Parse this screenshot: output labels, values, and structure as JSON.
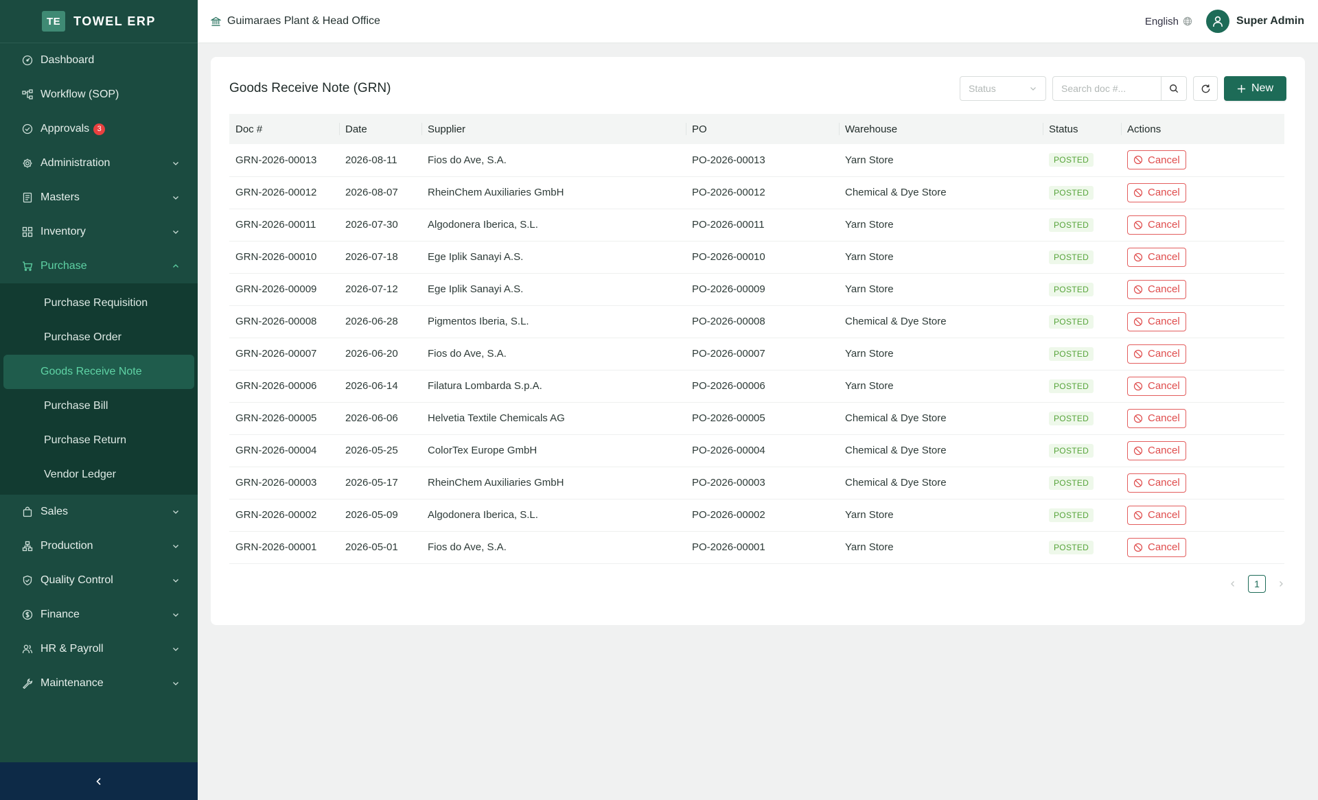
{
  "brand": {
    "logo": "TE",
    "name": "TOWEL ERP"
  },
  "colors": {
    "sidebar": "#1b4b40",
    "accent": "#1d6b57",
    "active_text": "#5fd3a5",
    "danger": "#df4c4c",
    "posted": "#56a43a",
    "collapse_bar": "#0d2a47"
  },
  "sidebar": {
    "items": [
      {
        "label": "Dashboard",
        "icon": "dashboard-icon"
      },
      {
        "label": "Workflow (SOP)",
        "icon": "workflow-icon"
      },
      {
        "label": "Approvals",
        "icon": "check-circle-icon",
        "badge": "3"
      },
      {
        "label": "Administration",
        "icon": "gear-icon"
      },
      {
        "label": "Masters",
        "icon": "book-icon"
      },
      {
        "label": "Inventory",
        "icon": "grid-icon"
      },
      {
        "label": "Purchase",
        "icon": "cart-icon"
      },
      {
        "label": "Sales",
        "icon": "shopping-bag-icon"
      },
      {
        "label": "Production",
        "icon": "cluster-icon"
      },
      {
        "label": "Quality Control",
        "icon": "shield-check-icon"
      },
      {
        "label": "Finance",
        "icon": "dollar-circle-icon"
      },
      {
        "label": "HR & Payroll",
        "icon": "team-icon"
      },
      {
        "label": "Maintenance",
        "icon": "tool-icon"
      }
    ],
    "purchase_sub": [
      "Purchase Requisition",
      "Purchase Order",
      "Goods Receive Note",
      "Purchase Bill",
      "Purchase Return",
      "Vendor Ledger"
    ]
  },
  "header": {
    "org": "Guimaraes Plant & Head Office",
    "language": "English",
    "user": "Super Admin"
  },
  "page": {
    "title": "Goods Receive Note (GRN)",
    "status_placeholder": "Status",
    "search_placeholder": "Search doc #...",
    "new_label": "New"
  },
  "table": {
    "columns": [
      "Doc #",
      "Date",
      "Supplier",
      "PO",
      "Warehouse",
      "Status",
      "Actions"
    ],
    "rows": [
      {
        "doc": "GRN-2026-00013",
        "date": "2026-08-11",
        "supplier": "Fios do Ave, S.A.",
        "po": "PO-2026-00013",
        "warehouse": "Yarn Store",
        "status": "POSTED",
        "action": "Cancel"
      },
      {
        "doc": "GRN-2026-00012",
        "date": "2026-08-07",
        "supplier": "RheinChem Auxiliaries GmbH",
        "po": "PO-2026-00012",
        "warehouse": "Chemical & Dye Store",
        "status": "POSTED",
        "action": "Cancel"
      },
      {
        "doc": "GRN-2026-00011",
        "date": "2026-07-30",
        "supplier": "Algodonera Iberica, S.L.",
        "po": "PO-2026-00011",
        "warehouse": "Yarn Store",
        "status": "POSTED",
        "action": "Cancel"
      },
      {
        "doc": "GRN-2026-00010",
        "date": "2026-07-18",
        "supplier": "Ege Iplik Sanayi A.S.",
        "po": "PO-2026-00010",
        "warehouse": "Yarn Store",
        "status": "POSTED",
        "action": "Cancel"
      },
      {
        "doc": "GRN-2026-00009",
        "date": "2026-07-12",
        "supplier": "Ege Iplik Sanayi A.S.",
        "po": "PO-2026-00009",
        "warehouse": "Yarn Store",
        "status": "POSTED",
        "action": "Cancel"
      },
      {
        "doc": "GRN-2026-00008",
        "date": "2026-06-28",
        "supplier": "Pigmentos Iberia, S.L.",
        "po": "PO-2026-00008",
        "warehouse": "Chemical & Dye Store",
        "status": "POSTED",
        "action": "Cancel"
      },
      {
        "doc": "GRN-2026-00007",
        "date": "2026-06-20",
        "supplier": "Fios do Ave, S.A.",
        "po": "PO-2026-00007",
        "warehouse": "Yarn Store",
        "status": "POSTED",
        "action": "Cancel"
      },
      {
        "doc": "GRN-2026-00006",
        "date": "2026-06-14",
        "supplier": "Filatura Lombarda S.p.A.",
        "po": "PO-2026-00006",
        "warehouse": "Yarn Store",
        "status": "POSTED",
        "action": "Cancel"
      },
      {
        "doc": "GRN-2026-00005",
        "date": "2026-06-06",
        "supplier": "Helvetia Textile Chemicals AG",
        "po": "PO-2026-00005",
        "warehouse": "Chemical & Dye Store",
        "status": "POSTED",
        "action": "Cancel"
      },
      {
        "doc": "GRN-2026-00004",
        "date": "2026-05-25",
        "supplier": "ColorTex Europe GmbH",
        "po": "PO-2026-00004",
        "warehouse": "Chemical & Dye Store",
        "status": "POSTED",
        "action": "Cancel"
      },
      {
        "doc": "GRN-2026-00003",
        "date": "2026-05-17",
        "supplier": "RheinChem Auxiliaries GmbH",
        "po": "PO-2026-00003",
        "warehouse": "Chemical & Dye Store",
        "status": "POSTED",
        "action": "Cancel"
      },
      {
        "doc": "GRN-2026-00002",
        "date": "2026-05-09",
        "supplier": "Algodonera Iberica, S.L.",
        "po": "PO-2026-00002",
        "warehouse": "Yarn Store",
        "status": "POSTED",
        "action": "Cancel"
      },
      {
        "doc": "GRN-2026-00001",
        "date": "2026-05-01",
        "supplier": "Fios do Ave, S.A.",
        "po": "PO-2026-00001",
        "warehouse": "Yarn Store",
        "status": "POSTED",
        "action": "Cancel"
      }
    ]
  },
  "pagination": {
    "current": "1"
  }
}
